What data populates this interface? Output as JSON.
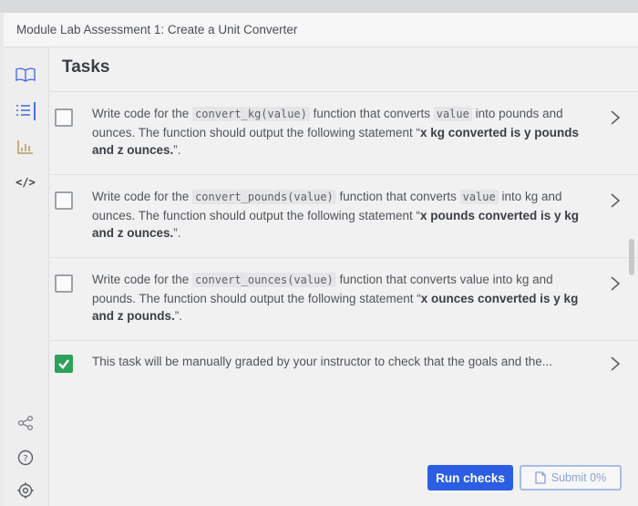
{
  "window": {
    "title": "Module Lab Assessment 1: Create a Unit Converter"
  },
  "rail": {
    "icons": [
      "book-icon",
      "list-icon",
      "chart-icon",
      "code-icon",
      "share-icon",
      "help-icon",
      "settings-icon"
    ],
    "code_glyph": "</>",
    "help_glyph": "?"
  },
  "panel": {
    "title": "Tasks"
  },
  "tasks": [
    {
      "done": false,
      "p1": "Write code for the ",
      "code1": "convert_kg(value)",
      "p2": " function that converts ",
      "code2": "value",
      "p3": " into pounds and ounces. The function should output the following statement “",
      "bold": "x kg converted is y pounds and z ounces.",
      "p4": "”."
    },
    {
      "done": false,
      "p1": "Write code for the ",
      "code1": "convert_pounds(value)",
      "p2": " function that converts ",
      "code2": "value",
      "p3": " into kg and ounces. The function should output the following statement “",
      "bold": "x pounds converted is y kg and z ounces.",
      "p4": "”."
    },
    {
      "done": false,
      "p1": "Write code for the ",
      "code1": "convert_ounces(value)",
      "p2": " function that converts value into kg and pounds. The function should output the following statement “",
      "bold": "x ounces converted is y kg and z pounds.",
      "p4": "”."
    },
    {
      "done": true,
      "p1": "This task will be manually graded by your instructor to check that the goals and the..."
    }
  ],
  "footer": {
    "run_label": "Run checks",
    "submit_label": "Submit 0%"
  },
  "colors": {
    "accent": "#2b5ee2",
    "done": "#2fa05a",
    "submit": "#a7bce6"
  }
}
